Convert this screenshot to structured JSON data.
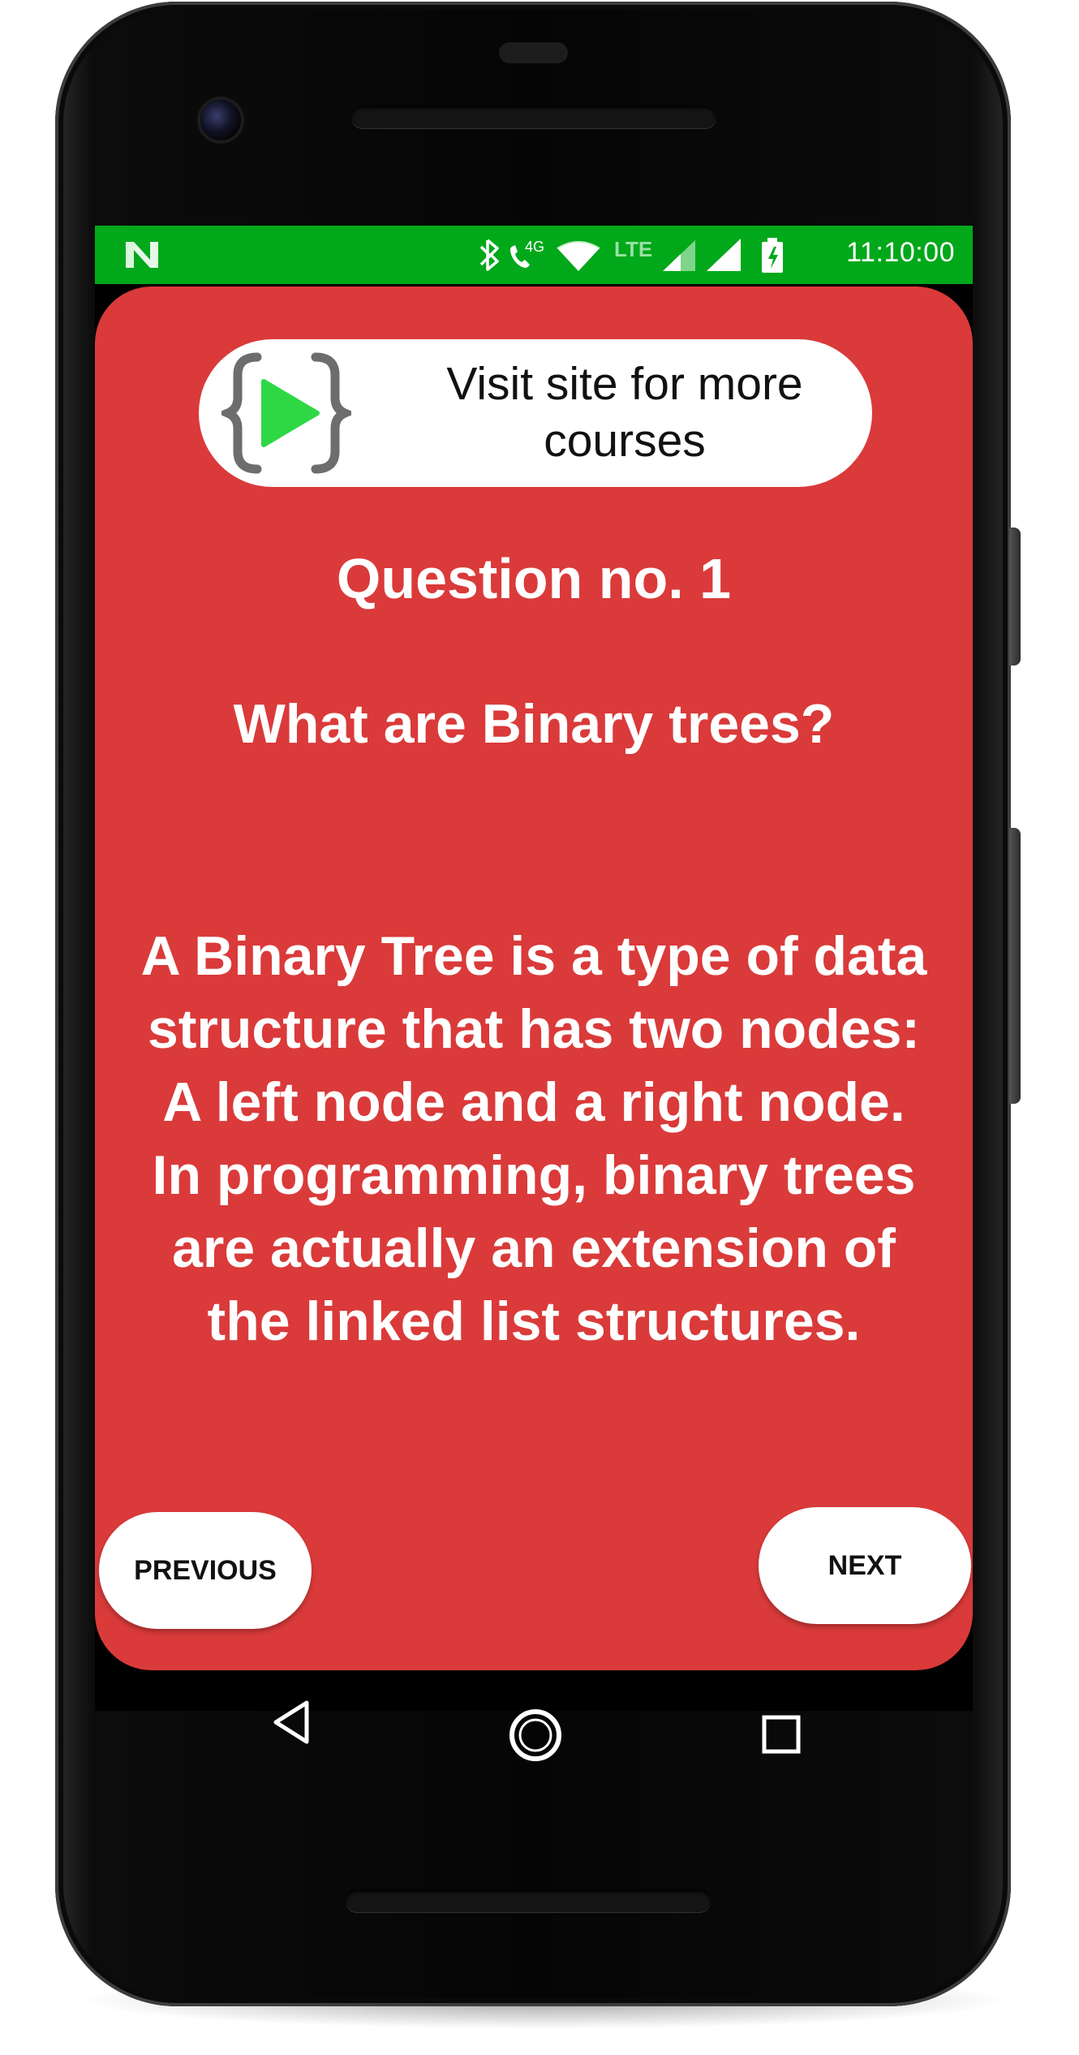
{
  "status_bar": {
    "time": "11:10:00",
    "icons": [
      "n-logo-icon",
      "bluetooth-icon",
      "phone-4g-icon",
      "wifi-icon",
      "lte-signal-icon",
      "cell-signal-icon",
      "battery-charging-icon"
    ],
    "network_label": "4G",
    "lte_label": "LTE",
    "color": "#00a81a"
  },
  "banner": {
    "label": "Visit site for more courses",
    "icon": "play-braces-logo-icon",
    "logo_green": "#2ed845"
  },
  "quiz": {
    "question_number": "Question no. 1",
    "question": "What are Binary trees?",
    "answer": "A Binary Tree is a type of data structure that has two nodes: A left node and a right node. In programming, binary trees are actually an extension of the linked list structures.",
    "background_color": "#da3a3a"
  },
  "buttons": {
    "previous_label": "PREVIOUS",
    "next_label": "NEXT"
  },
  "navigation": {
    "icons": [
      "back-triangle-icon",
      "home-circle-icon",
      "recents-square-icon"
    ]
  }
}
